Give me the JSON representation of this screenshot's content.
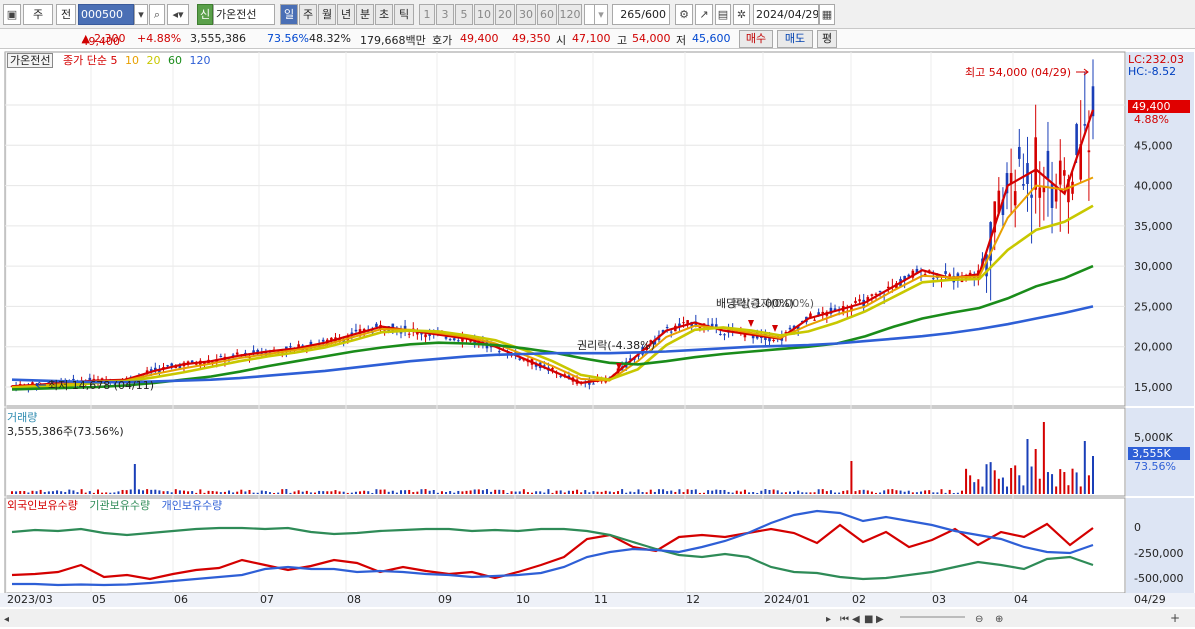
{
  "toolbar": {
    "mode": "주",
    "prev_label": "전",
    "code": "000500",
    "new_badge": "신",
    "stock_name": "가온전선",
    "periods": [
      "일",
      "주",
      "월",
      "년",
      "분",
      "초",
      "틱"
    ],
    "active_period": "일",
    "intervals": [
      "1",
      "3",
      "5",
      "10",
      "20",
      "30",
      "60",
      "120"
    ],
    "count": "265",
    "count_total": "/600",
    "date": "2024/04/29"
  },
  "quote": {
    "price": "49,400",
    "change": "2,300",
    "change_pct": "+4.88%",
    "volume": "3,555,386",
    "vol_ratio": "73.56%",
    "turnover": "48.32%",
    "amount": "179,668백만",
    "ask_label": "호가",
    "ask": "49,400",
    "bid": "49,350",
    "open_label": "시",
    "open": "47,100",
    "high_label": "고",
    "high": "54,000",
    "low_label": "저",
    "low": "45,600",
    "buy": "매수",
    "sell": "매도",
    "flag": "평"
  },
  "legend": {
    "name": "가온전선",
    "type": "종가 단순",
    "ma": [
      {
        "period": "5",
        "color": "#d40000"
      },
      {
        "period": "10",
        "color": "#e8a000"
      },
      {
        "period": "20",
        "color": "#c8c800"
      },
      {
        "period": "60",
        "color": "#1a8c1a"
      },
      {
        "period": "120",
        "color": "#2e5fd6"
      }
    ]
  },
  "price_axis": {
    "ticks": [
      "50,000",
      "45,000",
      "40,000",
      "35,000",
      "30,000",
      "25,000",
      "20,000",
      "15,000"
    ],
    "lc": "LC:232.03",
    "hc": "HC:-8.52",
    "current": "49,400",
    "current_pct": "4.88%"
  },
  "annotations": {
    "high": "최고 54,000 (04/29)",
    "low": "최저 14,678 (04/11)",
    "rights": "권리락(-4.38%)",
    "dividend": "배당락(-1.00%)",
    "dividend2": "무상증자(0.00%)"
  },
  "volume_panel": {
    "title": "거래량",
    "value": "3,555,386주(73.56%)",
    "tick": "5,000K",
    "current": "3,555K",
    "current_pct": "73.56%"
  },
  "holdings_panel": {
    "series": [
      {
        "name": "외국인보유수량",
        "color": "#d40000"
      },
      {
        "name": "기관보유수량",
        "color": "#2e8b57"
      },
      {
        "name": "개인보유수량",
        "color": "#2e5fd6"
      }
    ],
    "ticks": [
      "0",
      "-250,000",
      "-500,000"
    ]
  },
  "x_axis": {
    "labels": [
      "2023/03",
      "05",
      "06",
      "07",
      "08",
      "09",
      "10",
      "11",
      "12",
      "2024/01",
      "02",
      "03",
      "04"
    ],
    "end_label": "04/29"
  },
  "chart_data": {
    "type": "candlestick",
    "price_range": [
      12500,
      54000
    ],
    "ma_lines": [
      {
        "name": "5",
        "values": [
          15100,
          15300,
          15600,
          15800,
          15900,
          17000,
          17800,
          18200,
          18900,
          19400,
          19800,
          20500,
          21500,
          22500,
          22000,
          21500,
          21000,
          20000,
          18500,
          17000,
          15500,
          16000,
          19000,
          22000,
          23000,
          22000,
          21500,
          21000,
          23500,
          24500,
          25500,
          27500,
          29500,
          28500,
          29000,
          40000,
          42000,
          39000,
          49400
        ]
      },
      {
        "name": "10",
        "values": [
          15000,
          15200,
          15400,
          15700,
          15800,
          16600,
          17300,
          17900,
          18600,
          19100,
          19600,
          20200,
          21200,
          22200,
          22100,
          21700,
          21200,
          20400,
          19000,
          17600,
          16000,
          15800,
          18200,
          21200,
          22600,
          22300,
          21700,
          21100,
          22700,
          24000,
          25000,
          27000,
          28800,
          28600,
          28700,
          36000,
          40000,
          39500,
          41000
        ]
      },
      {
        "name": "20",
        "values": [
          14900,
          15000,
          15200,
          15500,
          15700,
          16200,
          16800,
          17500,
          18200,
          18800,
          19300,
          19900,
          20800,
          21800,
          22000,
          21900,
          21400,
          20800,
          19600,
          18200,
          16500,
          15900,
          17200,
          20200,
          22100,
          22400,
          22000,
          21400,
          21900,
          23000,
          24400,
          26200,
          28000,
          28300,
          28400,
          32000,
          34500,
          35500,
          37500
        ]
      },
      {
        "name": "60",
        "values": [
          14700,
          14800,
          14900,
          15000,
          15200,
          15500,
          15900,
          16300,
          16900,
          17600,
          18200,
          18800,
          19400,
          19900,
          20300,
          20500,
          20400,
          20200,
          19800,
          19300,
          18600,
          18000,
          17800,
          18200,
          18700,
          19100,
          19400,
          19700,
          20000,
          20400,
          21300,
          22500,
          23500,
          24200,
          24800,
          26000,
          27500,
          28500,
          30000
        ]
      },
      {
        "name": "120",
        "values": [
          15900,
          15800,
          15700,
          15600,
          15600,
          15700,
          15800,
          15900,
          16100,
          16400,
          16700,
          17000,
          17400,
          17800,
          18200,
          18500,
          18800,
          19000,
          19100,
          19200,
          19200,
          19200,
          19300,
          19400,
          19600,
          19800,
          20000,
          20100,
          20200,
          20400,
          20700,
          21000,
          21300,
          21700,
          22200,
          22800,
          23500,
          24200,
          25000
        ]
      }
    ],
    "high": 54000,
    "low": 14678
  }
}
